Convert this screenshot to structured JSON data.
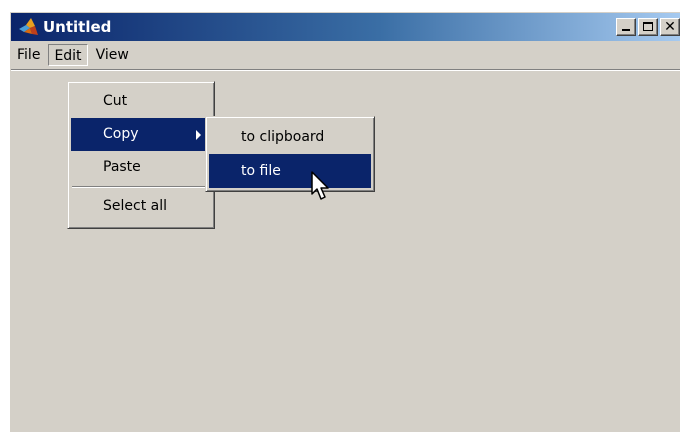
{
  "window": {
    "title": "Untitled",
    "controls": [
      "minimize",
      "maximize",
      "close"
    ]
  },
  "menubar": {
    "items": [
      {
        "label": "File"
      },
      {
        "label": "Edit",
        "active": true
      },
      {
        "label": "View"
      }
    ]
  },
  "edit_menu": {
    "items": [
      {
        "label": "Cut"
      },
      {
        "label": "Copy",
        "highlighted": true,
        "has_submenu": true
      },
      {
        "label": "Paste"
      },
      {
        "label": "Select all"
      }
    ]
  },
  "copy_submenu": {
    "items": [
      {
        "label": "to clipboard"
      },
      {
        "label": "to file",
        "highlighted": true
      }
    ]
  },
  "colors": {
    "highlight": "#0a246a",
    "window_bg": "#d4d0c8"
  }
}
